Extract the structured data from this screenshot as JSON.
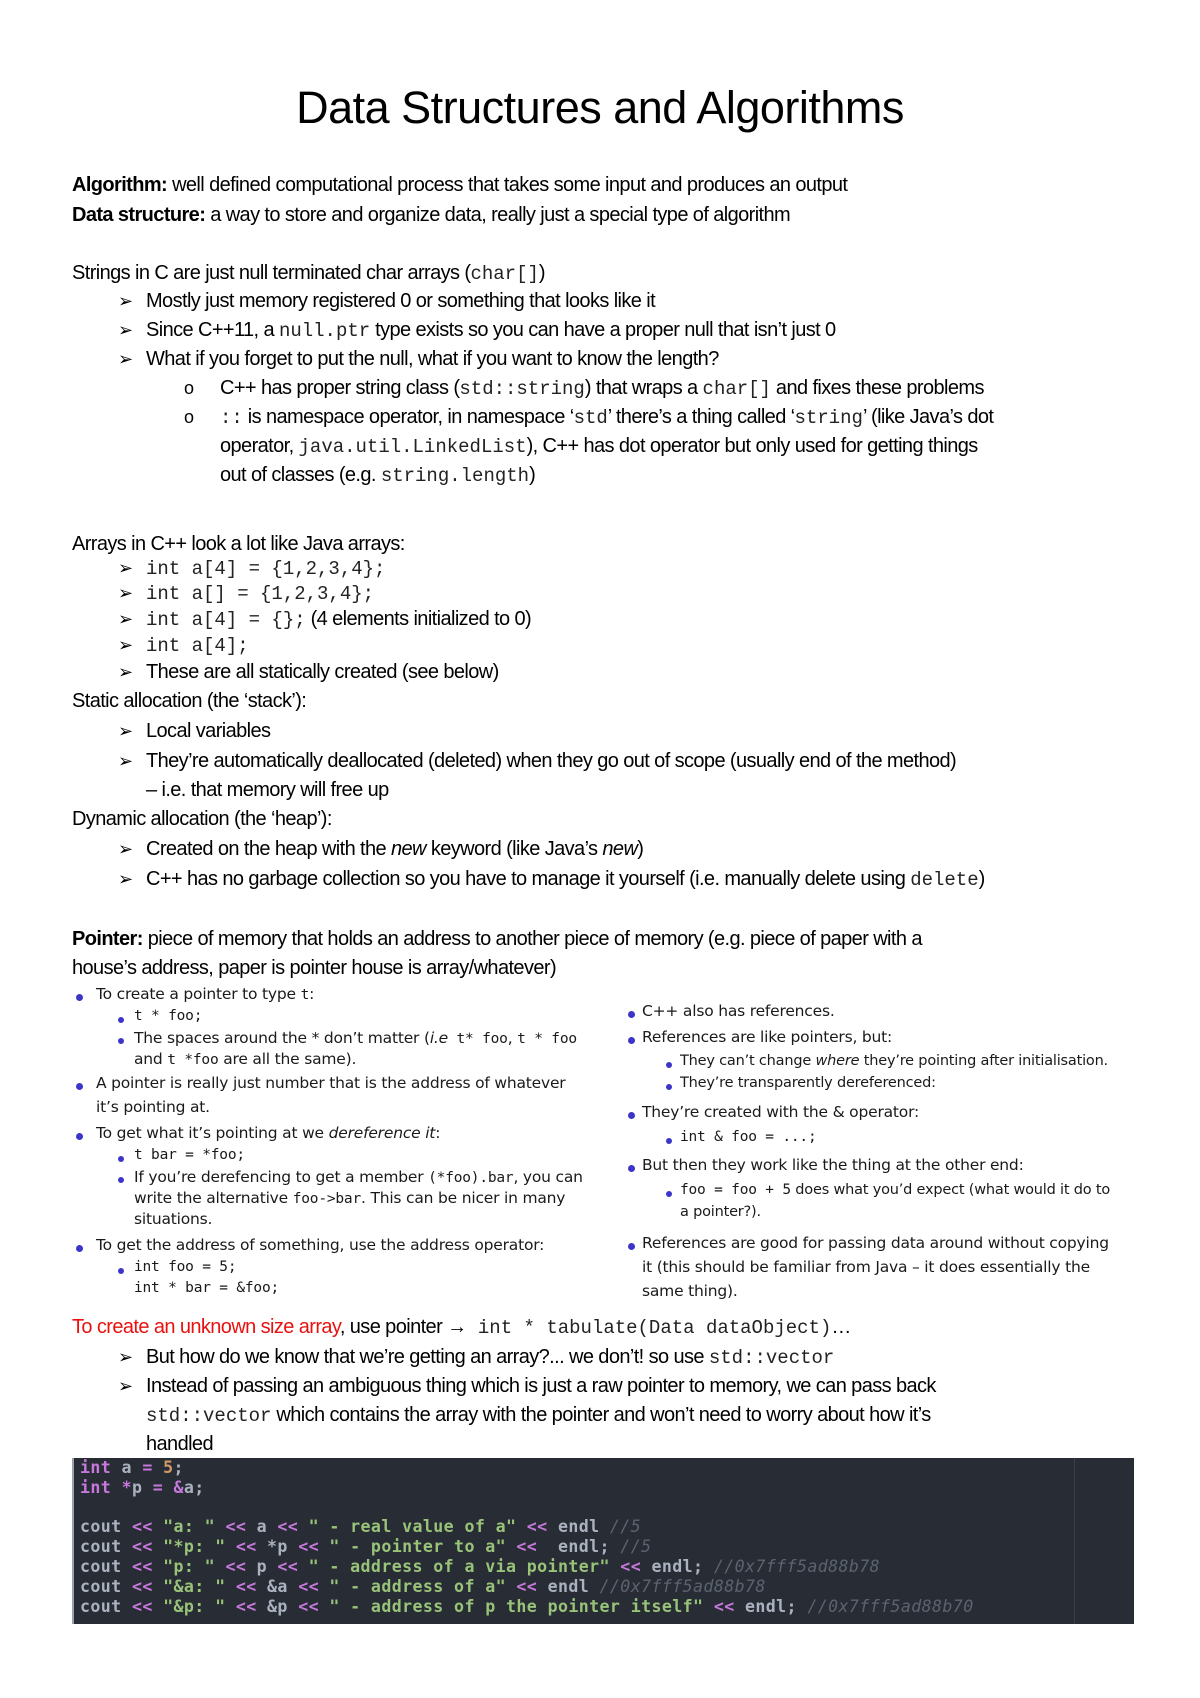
{
  "title": "Data Structures and Algorithms",
  "definitions": {
    "algorithm_term": "Algorithm:",
    "algorithm_text": " well defined computational process that takes some input and produces an output",
    "ds_term": "Data structure:",
    "ds_text": " a way to store and organize data, really just a special type of algorithm"
  },
  "strings": {
    "heading_pre": "Strings in C are just null terminated char arrays (",
    "heading_code": "char[]",
    "heading_post": ")",
    "b1": "Mostly just memory registered 0 or something that looks like it",
    "b2_pre": "Since C++11, a ",
    "b2_code": "null.ptr",
    "b2_post": " type exists so you can have a proper null that isn’t just 0",
    "b3": "What if you forget to put the null, what if you want to know the length?",
    "s1_pre": "C++ has proper string class (",
    "s1_code1": "std::string",
    "s1_mid": ") that wraps a ",
    "s1_code2": "char[]",
    "s1_post": " and fixes these problems",
    "s2_code1": "::",
    "s2_a": " is namespace operator, in namespace ‘",
    "s2_code2": "std",
    "s2_b": "’ there’s a thing called ‘",
    "s2_code3": "string",
    "s2_c": "’ (like Java’s dot",
    "s2_l2_pre": "operator, ",
    "s2_l2_code": "java.util.LinkedList",
    "s2_l2_post": "), C++ has dot operator but only used for getting things",
    "s2_l3_pre": "out of classes (e.g. ",
    "s2_l3_code": "string.length",
    "s2_l3_post": ")"
  },
  "arrays": {
    "heading": "Arrays in C++ look a lot like Java arrays:",
    "items": [
      {
        "code": "int a[4] = {1,2,3,4};",
        "note": ""
      },
      {
        "code": "int a[] = {1,2,3,4};",
        "note": ""
      },
      {
        "code": "int a[4] = {};",
        "note": " (4 elements initialized to 0)"
      },
      {
        "code": "int a[4];",
        "note": ""
      }
    ],
    "last": "These are all statically created (see below)"
  },
  "static_alloc": {
    "heading": "Static allocation (the ‘stack’):",
    "b1": "Local variables",
    "b2_l1": "They’re automatically deallocated (deleted) when they go out of scope (usually end of the method)",
    "b2_l2": "– i.e. that memory will free up"
  },
  "dynamic_alloc": {
    "heading": "Dynamic allocation (the ‘heap’):",
    "b1_pre": "Created on the heap with the ",
    "b1_em1": "new",
    "b1_mid": " keyword (like Java’s ",
    "b1_em2": "new",
    "b1_post": ")",
    "b2_pre": "C++ has no garbage collection so you have to manage it yourself (i.e. manually delete using ",
    "b2_code": "delete",
    "b2_post": ")"
  },
  "pointer": {
    "term": "Pointer:",
    "text_l1": " piece of memory that holds an address to another piece of memory (e.g. piece of paper with a",
    "text_l2": "house’s address, paper is pointer house is array/whatever)"
  },
  "slide_left": {
    "p1_pre": "To create a pointer to type ",
    "p1_code": "t",
    "p1_post": ":",
    "p1_s1": "t * foo;",
    "p1_s2_pre": "The spaces around the * don’t matter (",
    "p1_s2_em": "i.e",
    "p1_s2_c1": " t* foo",
    "p1_s2_sep": ", ",
    "p1_s2_c2": "t * foo",
    "p1_s2_l2_pre": "and ",
    "p1_s2_l2_code": "t *foo",
    "p1_s2_l2_post": " are all the same).",
    "p2_l1": "A pointer is really just number that is the address of whatever",
    "p2_l2": "it’s pointing at.",
    "p3_pre": "To get what it’s pointing at we ",
    "p3_em": "dereference it",
    "p3_post": ":",
    "p3_s1": "t bar = *foo;",
    "p3_s2_pre": "If you’re derefencing to get a member ",
    "p3_s2_code": "(*foo).bar",
    "p3_s2_post": ", you can",
    "p3_s2_l2_pre": "write the alternative ",
    "p3_s2_l2_code": "foo->bar",
    "p3_s2_l2_post": ". This can be nicer in many",
    "p3_s2_l3": "situations.",
    "p4": "To get the address of something, use the address operator:",
    "p4_s1": "int foo = 5;",
    "p4_s2": "int * bar = &foo;"
  },
  "slide_right": {
    "r1": "C++ also has references.",
    "r2": "References are like pointers, but:",
    "r2_s1_pre": "They can’t change ",
    "r2_s1_em": "where",
    "r2_s1_post": " they’re pointing after initialisation.",
    "r2_s2": "They’re transparently dereferenced:",
    "r3": "They’re created with the & operator:",
    "r3_s1": "int & foo = ...;",
    "r4": "But then they work like the thing at the other end:",
    "r4_s1_code": "foo = foo + 5",
    "r4_s1_post": " does what you’d expect (what would it do to",
    "r4_s1_l2": "a pointer?).",
    "r5_l1": "References are good for passing data around without copying",
    "r5_l2": "it (this should be familiar from Java – it does essentially the",
    "r5_l3": "same thing)."
  },
  "unknown_array": {
    "red": "To create an unknown size array",
    "mid": ", use pointer ",
    "arrow": "→",
    "code": " int * tabulate(Data dataObject)",
    "post": "…",
    "b1_pre": "But how do we know that we’re getting an array?... we don’t! so use ",
    "b1_code": "std::vector",
    "b2_l1": "Instead of passing an ambiguous thing which is just a raw pointer to memory, we can pass back",
    "b2_l2_code": "std::vector",
    "b2_l2_post": " which contains the array with the pointer and won’t need to worry about how it’s",
    "b2_l3": "handled"
  },
  "code_block": {
    "lines": [
      [
        "int",
        " a ",
        "=",
        " ",
        "5",
        ";"
      ],
      [
        "int",
        " ",
        "*",
        "p ",
        "=",
        " ",
        "&",
        "a;"
      ]
    ],
    "cout": [
      {
        "lbl": "\"a: \"",
        "var": " a ",
        "desc": "\" - real value of a\"",
        "end": " endl",
        "cmt": " //5"
      },
      {
        "lbl": "\"*p: \"",
        "var": " *p ",
        "desc": "\" - pointer to a\"",
        "end": "  endl;",
        "cmt": " //5"
      },
      {
        "lbl": "\"p: \"",
        "var": " p ",
        "desc": "\" - address of a via pointer\"",
        "end": " endl;",
        "cmt": " //0x7fff5ad88b78"
      },
      {
        "lbl": "\"&a: \"",
        "var": " &a ",
        "desc": "\" - address of a\"",
        "end": " endl",
        "cmt": " //0x7fff5ad88b78"
      },
      {
        "lbl": "\"&p: \"",
        "var": " &p ",
        "desc": "\" - address of p the pointer itself\"",
        "end": " endl;",
        "cmt": " //0x7fff5ad88b70"
      }
    ],
    "cout_kw": "cout",
    "shift_op": "<<",
    "colors": {
      "background": "#282c34",
      "keyword": "#c678dd",
      "number": "#d19a66",
      "string": "#98c379",
      "comment": "#5c6370",
      "text": "#abb2bf"
    }
  },
  "bullets": {
    "arrow": "➢",
    "circle": "o"
  },
  "colors": {
    "accent_red": "#e8110f",
    "slide_bullet": "#3c35c8"
  }
}
